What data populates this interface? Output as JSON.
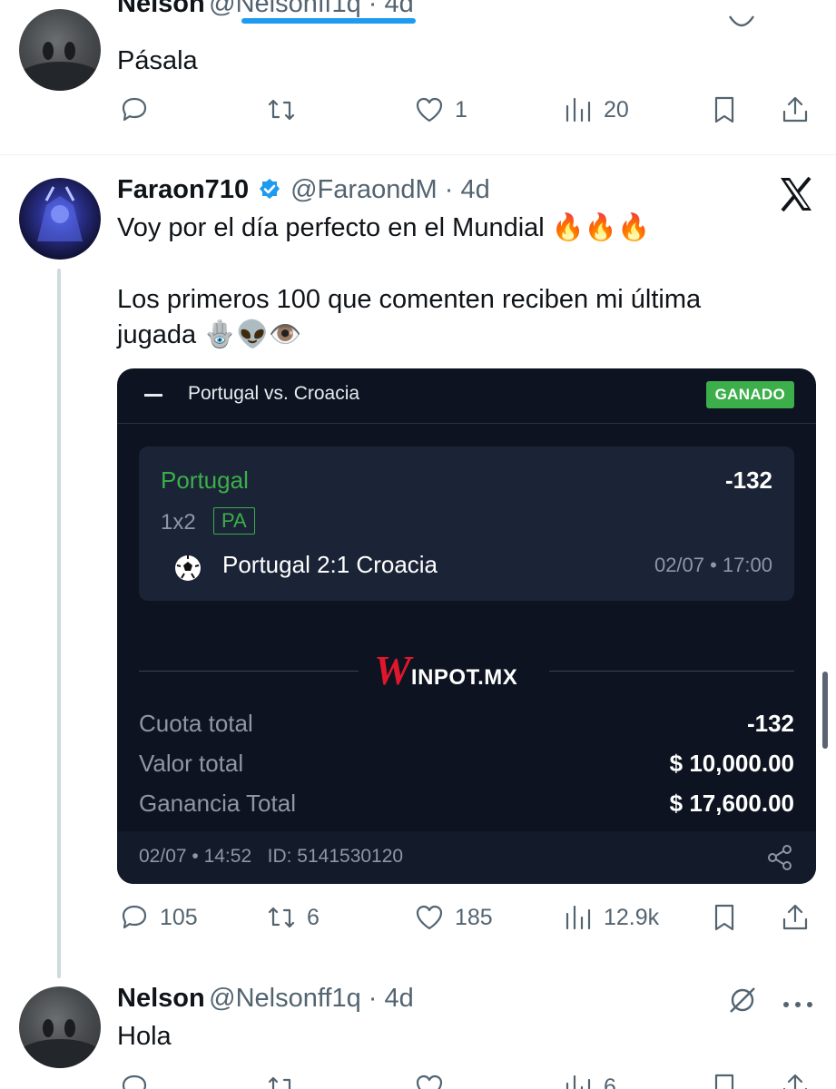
{
  "top_reply": {
    "name": "Nelson",
    "handle": "@Nelsonff1q · 4d",
    "text": "Pásala",
    "actions": {
      "replies": "",
      "reposts": "",
      "likes": "1",
      "views": "20"
    }
  },
  "main_tweet": {
    "name": "Faraon710",
    "handle": "@FaraondM · 4d",
    "text_line1": "Voy por el día perfecto en el Mundial 🔥🔥🔥",
    "text_line2": "Los primeros 100 que comenten reciben mi última",
    "text_line3": "jugada 🪬👽👁️",
    "actions": {
      "replies": "105",
      "reposts": "6",
      "likes": "185",
      "views": "12.9k"
    },
    "bet_card": {
      "title": "Portugal vs. Croacia",
      "status": "GANADO",
      "selection": "Portugal",
      "odds": "-132",
      "market": "1x2",
      "market_badge": "PA",
      "match": "Portugal 2:1 Croacia",
      "match_date": "02/07 • 17:00",
      "brand_w": "W",
      "brand_rest": "INPOT.MX",
      "rows": [
        {
          "label": "Cuota total",
          "value": "-132"
        },
        {
          "label": "Valor total",
          "value": "$ 10,000.00"
        },
        {
          "label": "Ganancia Total",
          "value": "$ 17,600.00"
        }
      ],
      "footer": "02/07 • 14:52   ID: 5141530120"
    }
  },
  "bottom_reply": {
    "name": "Nelson",
    "handle": "@Nelsonff1q · 4d",
    "text": "Hola",
    "actions": {
      "views": "6"
    }
  },
  "colors": {
    "verified": "#1d9bf0",
    "accent": "#1d9bf0",
    "win_green": "#3cae4a",
    "brand_red": "#e0162b"
  }
}
